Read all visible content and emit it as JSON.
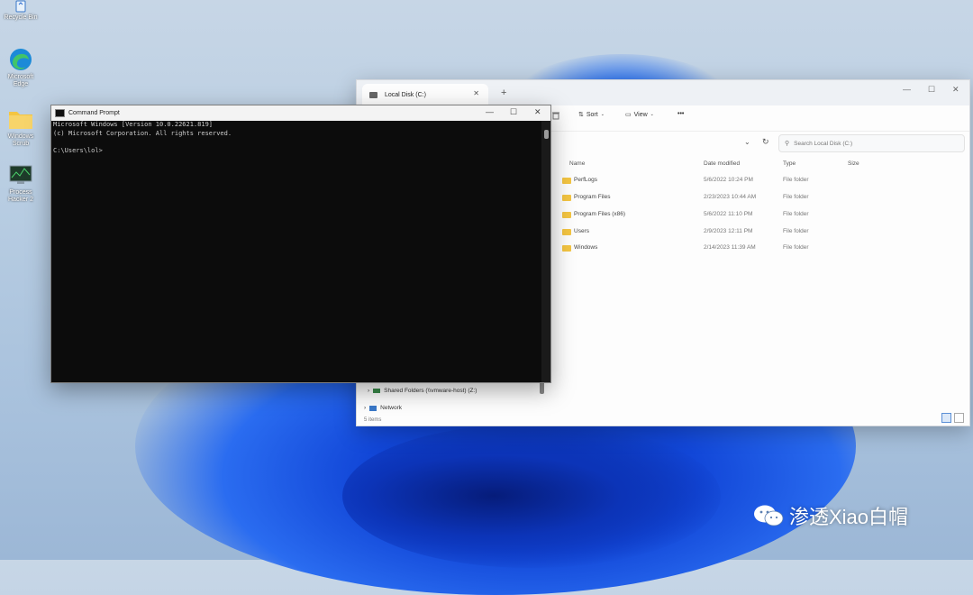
{
  "desktop": {
    "icons": [
      {
        "label": "Recycle Bin",
        "icon": "recycle-bin-icon"
      },
      {
        "label": "Microsoft Edge",
        "icon": "edge-icon"
      },
      {
        "label": "Windows Scrub",
        "icon": "folder-icon"
      },
      {
        "label": "Process Hacker 2",
        "icon": "process-hacker-icon"
      }
    ]
  },
  "explorer": {
    "tab_title": "Local Disk (C:)",
    "toolbar": {
      "sort_label": "Sort",
      "view_label": "View",
      "more_label": "•••"
    },
    "search_placeholder": "Search Local Disk (C:)",
    "columns": {
      "name": "Name",
      "date": "Date modified",
      "type": "Type",
      "size": "Size"
    },
    "rows": [
      {
        "name": "PerfLogs",
        "date": "5/6/2022 10:24 PM",
        "type": "File folder"
      },
      {
        "name": "Program Files",
        "date": "2/23/2023 10:44 AM",
        "type": "File folder"
      },
      {
        "name": "Program Files (x86)",
        "date": "5/6/2022 11:10 PM",
        "type": "File folder"
      },
      {
        "name": "Users",
        "date": "2/9/2023 12:11 PM",
        "type": "File folder"
      },
      {
        "name": "Windows",
        "date": "2/14/2023 11:39 AM",
        "type": "File folder"
      }
    ],
    "nav": {
      "shared_folders": "Shared Folders (\\\\vmware-host) (Z:)",
      "network": "Network"
    },
    "status": "5 items"
  },
  "cmd": {
    "title": "Command Prompt",
    "lines": [
      "Microsoft Windows [Version 10.0.22621.819]",
      "(c) Microsoft Corporation. All rights reserved.",
      "",
      "C:\\Users\\lol>"
    ]
  },
  "watermark": {
    "text": "渗透Xiao白帽"
  },
  "colors": {
    "folder": "#f4c542",
    "accent": "#0a5fd6",
    "console_bg": "#0c0c0c",
    "console_fg": "#cccccc"
  }
}
